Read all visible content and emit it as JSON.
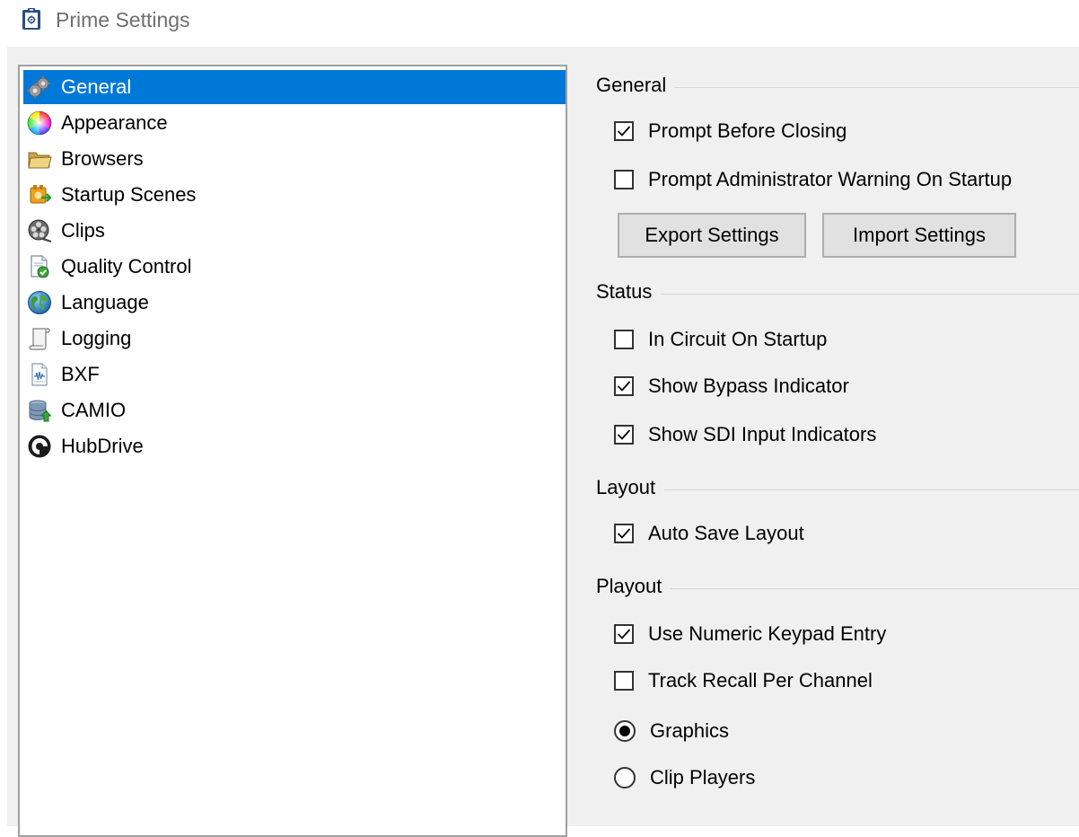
{
  "window": {
    "title": "Prime Settings",
    "icon": "clipboard-settings-icon"
  },
  "colors": {
    "selection": "#0078d7",
    "panel_background": "#f0f0f0"
  },
  "nav": {
    "selected": "General",
    "items": [
      {
        "label": "General",
        "icon": "gears-icon"
      },
      {
        "label": "Appearance",
        "icon": "color-wheel-icon"
      },
      {
        "label": "Browsers",
        "icon": "folder-icon"
      },
      {
        "label": "Startup Scenes",
        "icon": "startup-scenes-icon"
      },
      {
        "label": "Clips",
        "icon": "film-reel-icon"
      },
      {
        "label": "Quality Control",
        "icon": "document-check-icon"
      },
      {
        "label": "Language",
        "icon": "globe-icon"
      },
      {
        "label": "Logging",
        "icon": "scroll-icon"
      },
      {
        "label": "BXF",
        "icon": "waveform-document-icon"
      },
      {
        "label": "CAMIO",
        "icon": "database-arrow-icon"
      },
      {
        "label": "HubDrive",
        "icon": "hubdrive-logo-icon"
      }
    ]
  },
  "general": {
    "title": "General",
    "prompt_before_closing": {
      "label": "Prompt Before Closing",
      "checked": true
    },
    "prompt_admin_warning": {
      "label": "Prompt Administrator Warning On Startup",
      "checked": false
    },
    "export_button": "Export Settings",
    "import_button": "Import Settings"
  },
  "status": {
    "title": "Status",
    "in_circuit_on_startup": {
      "label": "In Circuit On Startup",
      "checked": false
    },
    "show_bypass_indicator": {
      "label": "Show Bypass Indicator",
      "checked": true
    },
    "show_sdi_input_indicators": {
      "label": "Show SDI Input Indicators",
      "checked": true
    }
  },
  "layout": {
    "title": "Layout",
    "auto_save_layout": {
      "label": "Auto Save Layout",
      "checked": true
    }
  },
  "playout": {
    "title": "Playout",
    "use_numeric_keypad_entry": {
      "label": "Use Numeric Keypad Entry",
      "checked": true
    },
    "track_recall_per_channel": {
      "label": "Track Recall Per Channel",
      "checked": false
    },
    "mode_options": [
      {
        "label": "Graphics",
        "selected": true
      },
      {
        "label": "Clip Players",
        "selected": false
      }
    ]
  }
}
